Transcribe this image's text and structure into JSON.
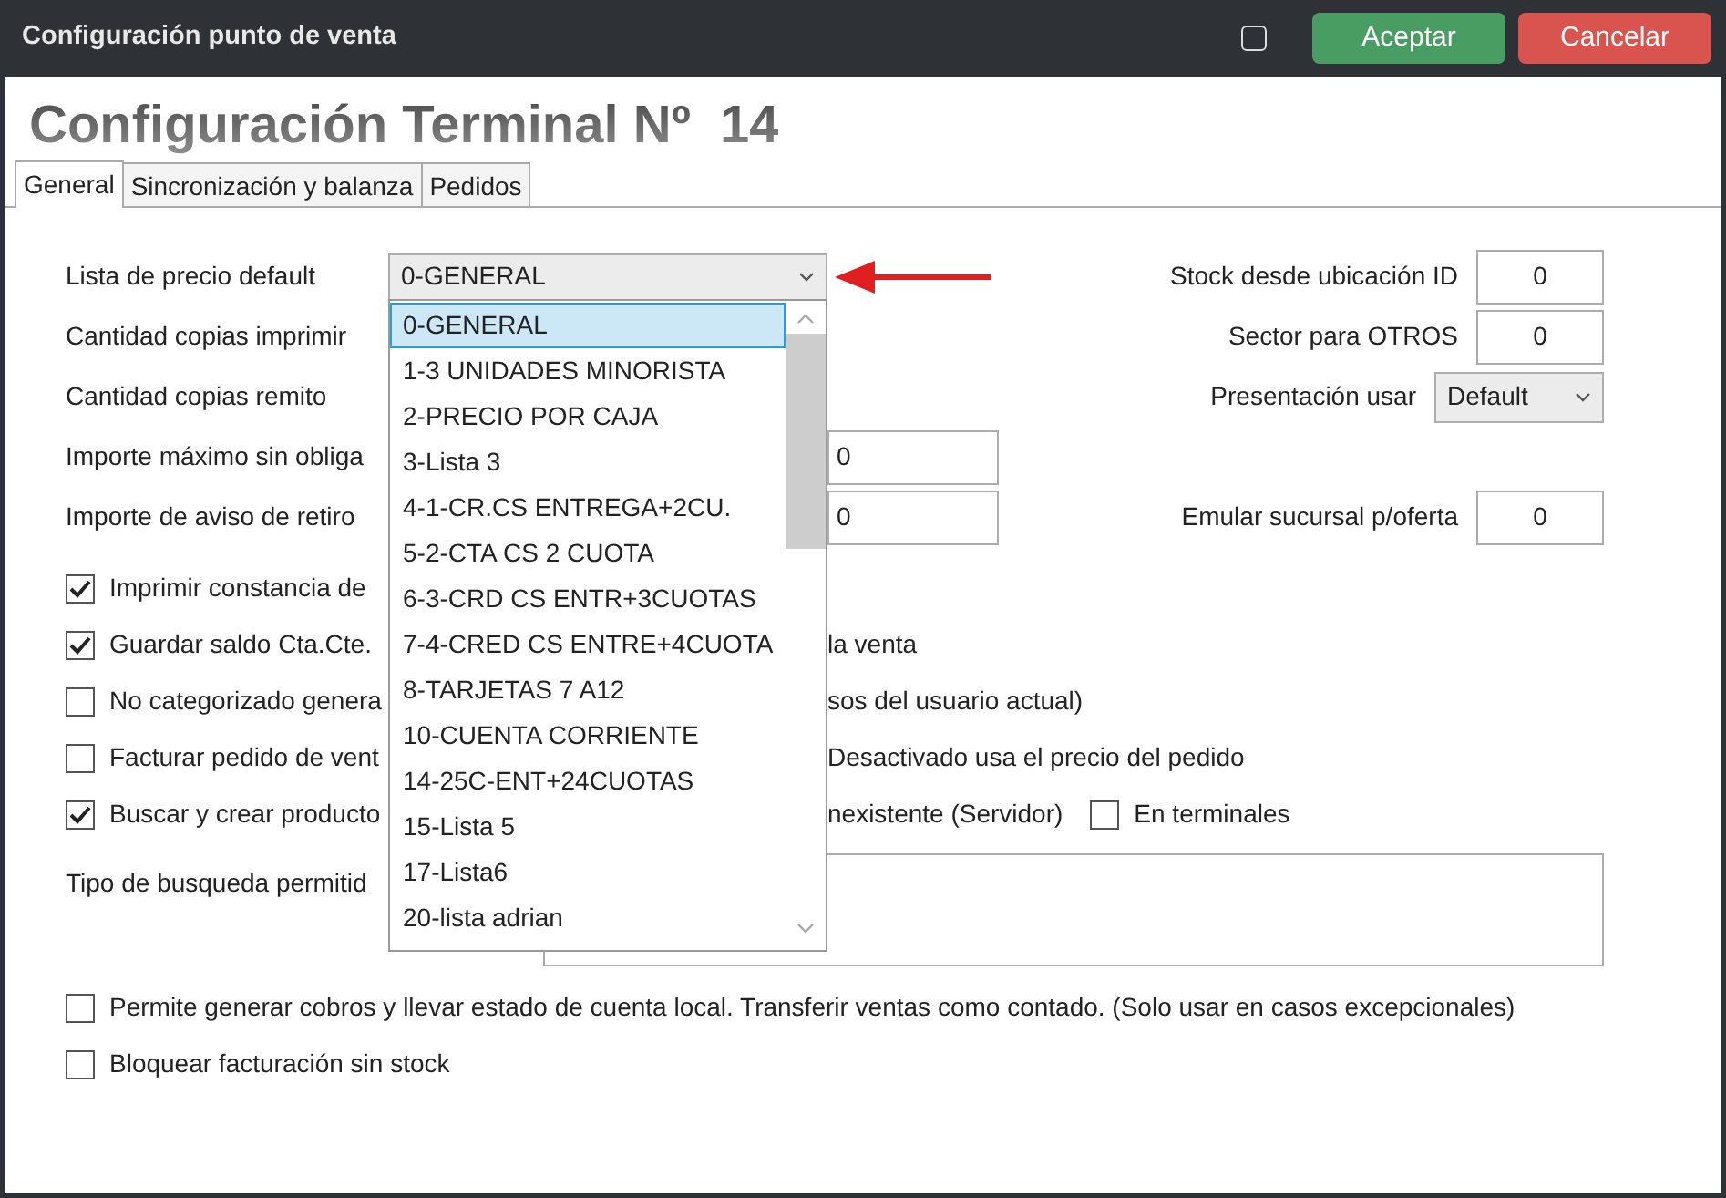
{
  "window": {
    "title": "Configuración punto de venta",
    "checkbox": {
      "checked": false
    }
  },
  "buttons": [
    {
      "label": "Aceptar",
      "kind": "accept"
    },
    {
      "label": "Cancelar",
      "kind": "cancel"
    }
  ],
  "heading": "Configuración Terminal Nº  14",
  "tabs": [
    {
      "label": "General",
      "selected": true
    },
    {
      "label": "Sincronización y balanza",
      "selected": false
    },
    {
      "label": "Pedidos",
      "selected": false
    }
  ],
  "rows": [
    {
      "left": {
        "label": "Lista de precio default",
        "kind": "select",
        "value": "0-GENERAL"
      },
      "right": {
        "label": "Stock desde ubicación ID",
        "kind": "input",
        "value": "0"
      }
    },
    {
      "left": {
        "label": "Cantidad copias imprimir",
        "kind": "covered"
      },
      "right": {
        "label": "Sector para OTROS",
        "kind": "input",
        "value": "0"
      }
    },
    {
      "left": {
        "label": "Cantidad copias remito",
        "kind": "covered"
      },
      "right": {
        "label": "Presentación usar",
        "kind": "select",
        "value": "Default"
      }
    },
    {
      "left": {
        "label": "Importe máximo sin obliga",
        "kind": "input",
        "value": "0"
      }
    },
    {
      "left": {
        "label": "Importe de aviso de retiro",
        "kind": "input",
        "value": "0"
      },
      "right": {
        "label": "Emular sucursal p/oferta",
        "kind": "input",
        "value": "0"
      }
    }
  ],
  "dropdown": {
    "expanded": true,
    "items": [
      {
        "label": "0-GENERAL",
        "selected": true
      },
      {
        "label": "1-3 UNIDADES MINORISTA",
        "selected": false
      },
      {
        "label": "2-PRECIO POR CAJA",
        "selected": false
      },
      {
        "label": "3-Lista 3",
        "selected": false
      },
      {
        "label": "4-1-CR.CS ENTREGA+2CU.",
        "selected": false
      },
      {
        "label": "5-2-CTA CS 2 CUOTA",
        "selected": false
      },
      {
        "label": "6-3-CRD CS ENTR+3CUOTAS",
        "selected": false
      },
      {
        "label": "7-4-CRED CS ENTRE+4CUOTA",
        "selected": false
      },
      {
        "label": "8-TARJETAS 7 A12",
        "selected": false
      },
      {
        "label": "10-CUENTA CORRIENTE",
        "selected": false
      },
      {
        "label": "14-25C-ENT+24CUOTAS",
        "selected": false
      },
      {
        "label": "15-Lista 5",
        "selected": false
      },
      {
        "label": "17-Lista6",
        "selected": false
      },
      {
        "label": "20-lista adrian",
        "selected": false
      }
    ]
  },
  "checkboxes": [
    {
      "label": "Imprimir constancia de",
      "checked": true
    },
    {
      "label": "Guardar saldo Cta.Cte.",
      "tail": "la venta",
      "checked": true
    },
    {
      "label": "No categorizado genera",
      "tail": "sos del usuario actual)",
      "checked": false
    },
    {
      "label": "Facturar pedido de vent",
      "tail": "Desactivado usa el precio del pedido",
      "checked": false
    },
    {
      "label": "Buscar y crear producto",
      "tail": "nexistente (Servidor)",
      "checked": true,
      "extra": {
        "label": "En terminales",
        "checked": false
      }
    }
  ],
  "search_type": {
    "label": "Tipo de busqueda permitid"
  },
  "bottom_checkboxes": [
    {
      "label": "Permite generar cobros y llevar estado de cuenta local. Transferir ventas como contado. (Solo usar en casos excepcionales)",
      "checked": false
    },
    {
      "label": "Bloquear facturación sin stock",
      "checked": false
    }
  ]
}
